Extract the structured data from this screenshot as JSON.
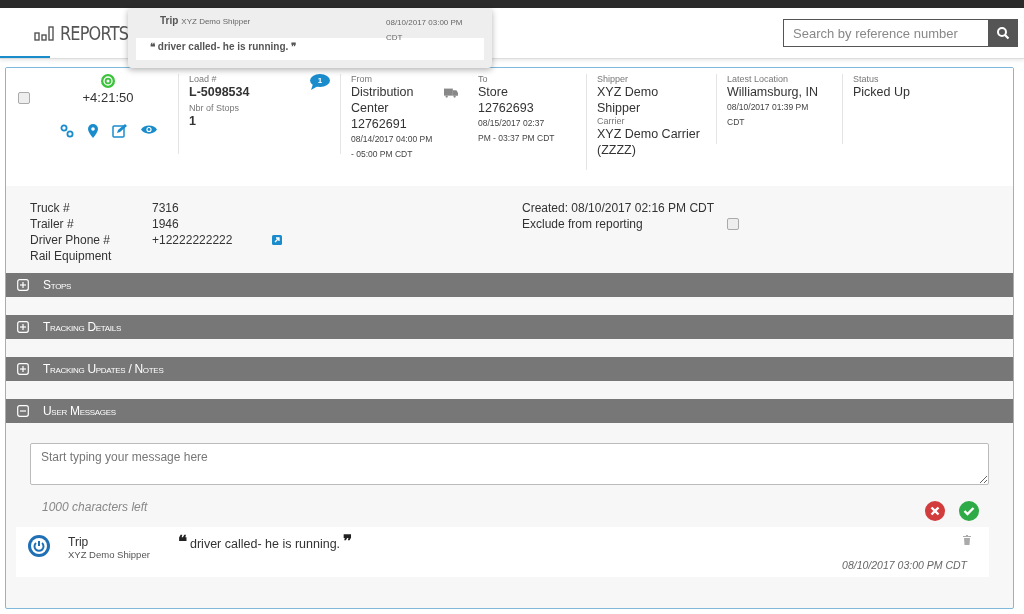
{
  "header": {
    "nav_label": "REPORTS",
    "search_placeholder": "Search by reference number"
  },
  "tooltip": {
    "title": "Trip",
    "subtitle": "XYZ Demo Shipper",
    "time": "08/10/2017 03:00 PM CDT",
    "text": "❝ driver called- he is running. ❞"
  },
  "load": {
    "selected": false,
    "elapsed": "+4:21:50",
    "load_label": "Load #",
    "load_number": "L-5098534",
    "stops_label": "Nbr of Stops",
    "stops": "1",
    "message_count": "1",
    "from": {
      "label": "From",
      "name": "Distribution Center",
      "ref": "12762691",
      "window": "08/14/2017 04:00 PM - 05:00 PM CDT"
    },
    "to": {
      "label": "To",
      "name": "Store",
      "ref": "12762693",
      "window": "08/15/2017 02:37 PM - 03:37 PM CDT"
    },
    "shipper_label": "Shipper",
    "shipper": "XYZ Demo Shipper",
    "carrier_label": "Carrier",
    "carrier": "XYZ Demo Carrier (ZZZZ)",
    "location_label": "Latest Location",
    "location": "Williamsburg, IN",
    "location_time": "08/10/2017 01:39 PM CDT",
    "status_label": "Status",
    "status": "Picked Up"
  },
  "details": {
    "rows": [
      {
        "label": "Truck #",
        "value": "7316",
        "kind": "text"
      },
      {
        "label": "Trailer #",
        "value": "1946",
        "kind": "text"
      },
      {
        "label": "Driver Phone #",
        "value": "+12222222222",
        "kind": "link"
      },
      {
        "label": "Rail Equipment",
        "kind": "text"
      }
    ],
    "created": "Created: 08/10/2017 02:16 PM CDT",
    "exclude_label": "Exclude from reporting",
    "exclude_checked": false
  },
  "sections": [
    {
      "title": "Stops",
      "expanded": false
    },
    {
      "title": "Tracking Details",
      "expanded": false
    },
    {
      "title": "Tracking Updates / Notes",
      "expanded": false
    },
    {
      "title": "User Messages",
      "expanded": true
    }
  ],
  "messages": {
    "placeholder": "Start typing your message here",
    "chars_left": "1000 characters left",
    "items": [
      {
        "title": "Trip",
        "subtitle": "XYZ Demo Shipper",
        "open_quote": "❝",
        "text": "driver called- he is running.",
        "close_quote": "❞",
        "time": "08/10/2017 03:00 PM CDT"
      }
    ]
  }
}
